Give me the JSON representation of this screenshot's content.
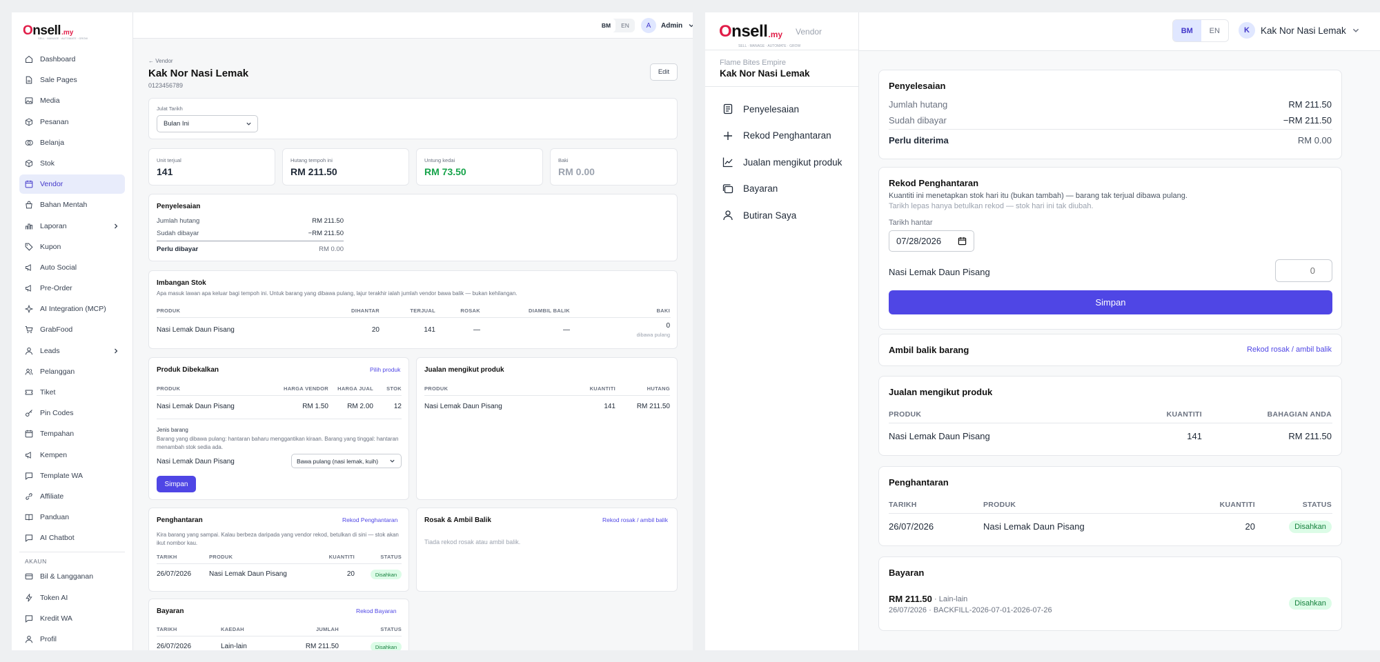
{
  "brand": {
    "name_pre": "",
    "name_o": "O",
    "name_post": "nsell",
    "suffix": ".my",
    "tagline": "SELL · MANAGE · AUTOMATE · GROW"
  },
  "admin": {
    "nav": [
      {
        "label": "Dashboard",
        "icon": "home-icon"
      },
      {
        "label": "Sale Pages",
        "icon": "file-icon"
      },
      {
        "label": "Media",
        "icon": "image-icon"
      },
      {
        "label": "Pesanan",
        "icon": "box-icon"
      },
      {
        "label": "Belanja",
        "icon": "coins-icon"
      },
      {
        "label": "Stok",
        "icon": "box-icon"
      },
      {
        "label": "Vendor",
        "icon": "calendar-icon",
        "active": true
      },
      {
        "label": "Bahan Mentah",
        "icon": "bag-icon"
      },
      {
        "label": "Laporan",
        "icon": "bar-chart-icon",
        "chevron": true
      },
      {
        "label": "Kupon",
        "icon": "tag-icon"
      },
      {
        "label": "Auto Social",
        "icon": "megaphone-icon"
      },
      {
        "label": "Pre-Order",
        "icon": "megaphone-icon"
      },
      {
        "label": "AI Integration (MCP)",
        "icon": "sparkle-icon"
      },
      {
        "label": "GrabFood",
        "icon": "cart-icon"
      },
      {
        "label": "Leads",
        "icon": "user-icon",
        "chevron": true
      },
      {
        "label": "Pelanggan",
        "icon": "users-icon"
      },
      {
        "label": "Tiket",
        "icon": "ticket-icon"
      },
      {
        "label": "Pin Codes",
        "icon": "key-icon"
      },
      {
        "label": "Tempahan",
        "icon": "calendar-icon"
      },
      {
        "label": "Kempen",
        "icon": "megaphone-icon"
      },
      {
        "label": "Template WA",
        "icon": "chat-icon"
      },
      {
        "label": "Affiliate",
        "icon": "link-icon"
      },
      {
        "label": "Panduan",
        "icon": "book-icon"
      },
      {
        "label": "AI Chatbot",
        "icon": "chat-icon"
      }
    ],
    "account_heading": "AKAUN",
    "account_nav": [
      {
        "label": "Bil & Langganan",
        "icon": "card-icon"
      },
      {
        "label": "Token AI",
        "icon": "bolt-icon"
      },
      {
        "label": "Kredit WA",
        "icon": "chat-icon"
      },
      {
        "label": "Profil",
        "icon": "user-icon"
      }
    ],
    "lang": {
      "bm": "BM",
      "en": "EN"
    },
    "user": {
      "initial": "A",
      "name": "Admin"
    },
    "back": "← Vendor",
    "vendor_name": "Kak Nor Nasi Lemak",
    "vendor_phone": "0123456789",
    "edit": "Edit",
    "date_range": {
      "label": "Julat Tarikh",
      "value": "Bulan Ini"
    },
    "stats": [
      {
        "label": "Unit terjual",
        "value": "141"
      },
      {
        "label": "Hutang tempoh ini",
        "value": "RM 211.50"
      },
      {
        "label": "Untung kedai",
        "value": "RM 73.50"
      },
      {
        "label": "Baki",
        "value": "RM 0.00"
      }
    ],
    "settlement": {
      "title": "Penyelesaian",
      "rows": [
        {
          "label": "Jumlah hutang",
          "value": "RM 211.50"
        },
        {
          "label": "Sudah dibayar",
          "value": "−RM 211.50"
        }
      ],
      "total_label": "Perlu dibayar",
      "total_value": "RM 0.00"
    },
    "stock_balance": {
      "title": "Imbangan Stok",
      "desc": "Apa masuk lawan apa keluar bagi tempoh ini. Untuk barang yang dibawa pulang, lajur terakhir ialah jumlah vendor bawa balik — bukan kehilangan.",
      "headers": [
        "PRODUK",
        "DIHANTAR",
        "TERJUAL",
        "ROSAK",
        "DIAMBIL BALIK",
        "BAKI"
      ],
      "row": {
        "product": "Nasi Lemak Daun Pisang",
        "sent": "20",
        "sold": "141",
        "damaged": "—",
        "taken": "—",
        "balance": "0",
        "note": "dibawa pulang"
      }
    },
    "supplied": {
      "title": "Produk Dibekalkan",
      "link": "Pilih produk",
      "headers": [
        "PRODUK",
        "HARGA VENDOR",
        "HARGA JUAL",
        "STOK"
      ],
      "row": {
        "product": "Nasi Lemak Daun Pisang",
        "vendor_price": "RM 1.50",
        "sell_price": "RM 2.00",
        "stock": "12"
      },
      "type_label": "Jenis barang",
      "type_desc": "Barang yang dibawa pulang: hantaran baharu menggantikan kiraan. Barang yang tinggal: hantaran menambah stok sedia ada.",
      "type_product": "Nasi Lemak Daun Pisang",
      "type_value": "Bawa pulang (nasi lemak, kuih)",
      "save": "Simpan"
    },
    "sales": {
      "title": "Jualan mengikut produk",
      "headers": [
        "PRODUK",
        "KUANTITI",
        "HUTANG"
      ],
      "row": {
        "product": "Nasi Lemak Daun Pisang",
        "qty": "141",
        "debt": "RM 211.50"
      }
    },
    "deliveries": {
      "title": "Penghantaran",
      "link": "Rekod Penghantaran",
      "desc": "Kira barang yang sampai. Kalau berbeza daripada yang vendor rekod, betulkan di sini — stok akan ikut nombor kau.",
      "headers": [
        "TARIKH",
        "PRODUK",
        "KUANTITI",
        "STATUS"
      ],
      "row": {
        "date": "26/07/2026",
        "product": "Nasi Lemak Daun Pisang",
        "qty": "20",
        "status": "Disahkan"
      }
    },
    "damaged": {
      "title": "Rosak & Ambil Balik",
      "link": "Rekod rosak / ambil balik",
      "empty": "Tiada rekod rosak atau ambil balik."
    },
    "payments": {
      "title": "Bayaran",
      "link": "Rekod Bayaran",
      "headers": [
        "TARIKH",
        "KAEDAH",
        "JUMLAH",
        "STATUS"
      ],
      "row": {
        "date": "26/07/2026",
        "method": "Lain-lain",
        "amount": "RM 211.50",
        "status": "Disahkan"
      }
    }
  },
  "vendor": {
    "label": "Vendor",
    "company": "Flame Bites Empire",
    "name": "Kak Nor Nasi Lemak",
    "nav": [
      {
        "label": "Penyelesaian",
        "icon": "document-icon"
      },
      {
        "label": "Rekod Penghantaran",
        "icon": "plus-icon"
      },
      {
        "label": "Jualan mengikut produk",
        "icon": "line-chart-icon"
      },
      {
        "label": "Bayaran",
        "icon": "wallet-icon"
      },
      {
        "label": "Butiran Saya",
        "icon": "user-icon"
      }
    ],
    "lang": {
      "bm": "BM",
      "en": "EN"
    },
    "user": {
      "initial": "K",
      "name": "Kak Nor Nasi Lemak"
    },
    "settlement": {
      "title": "Penyelesaian",
      "rows": [
        {
          "label": "Jumlah hutang",
          "value": "RM 211.50"
        },
        {
          "label": "Sudah dibayar",
          "value": "−RM 211.50"
        }
      ],
      "total_label": "Perlu diterima",
      "total_value": "RM 0.00"
    },
    "delivery_form": {
      "title": "Rekod Penghantaran",
      "desc1": "Kuantiti ini menetapkan stok hari itu (bukan tambah) — barang tak terjual dibawa pulang.",
      "desc2": "Tarikh lepas hanya betulkan rekod — stok hari ini tak diubah.",
      "date_label": "Tarikh hantar",
      "date_value": "07/28/2026",
      "product": "Nasi Lemak Daun Pisang",
      "qty_placeholder": "0",
      "save": "Simpan"
    },
    "takeback": {
      "title": "Ambil balik barang",
      "link": "Rekod rosak / ambil balik"
    },
    "sales": {
      "title": "Jualan mengikut produk",
      "headers": [
        "PRODUK",
        "KUANTITI",
        "BAHAGIAN ANDA"
      ],
      "row": {
        "product": "Nasi Lemak Daun Pisang",
        "qty": "141",
        "share": "RM 211.50"
      }
    },
    "deliveries": {
      "title": "Penghantaran",
      "headers": [
        "TARIKH",
        "PRODUK",
        "KUANTITI",
        "STATUS"
      ],
      "row": {
        "date": "26/07/2026",
        "product": "Nasi Lemak Daun Pisang",
        "qty": "20",
        "status": "Disahkan"
      }
    },
    "payments": {
      "title": "Bayaran",
      "amount": "RM 211.50",
      "method": "· Lain-lain",
      "meta": "26/07/2026 · BACKFILL-2026-07-01-2026-07-26",
      "status": "Disahkan"
    }
  }
}
